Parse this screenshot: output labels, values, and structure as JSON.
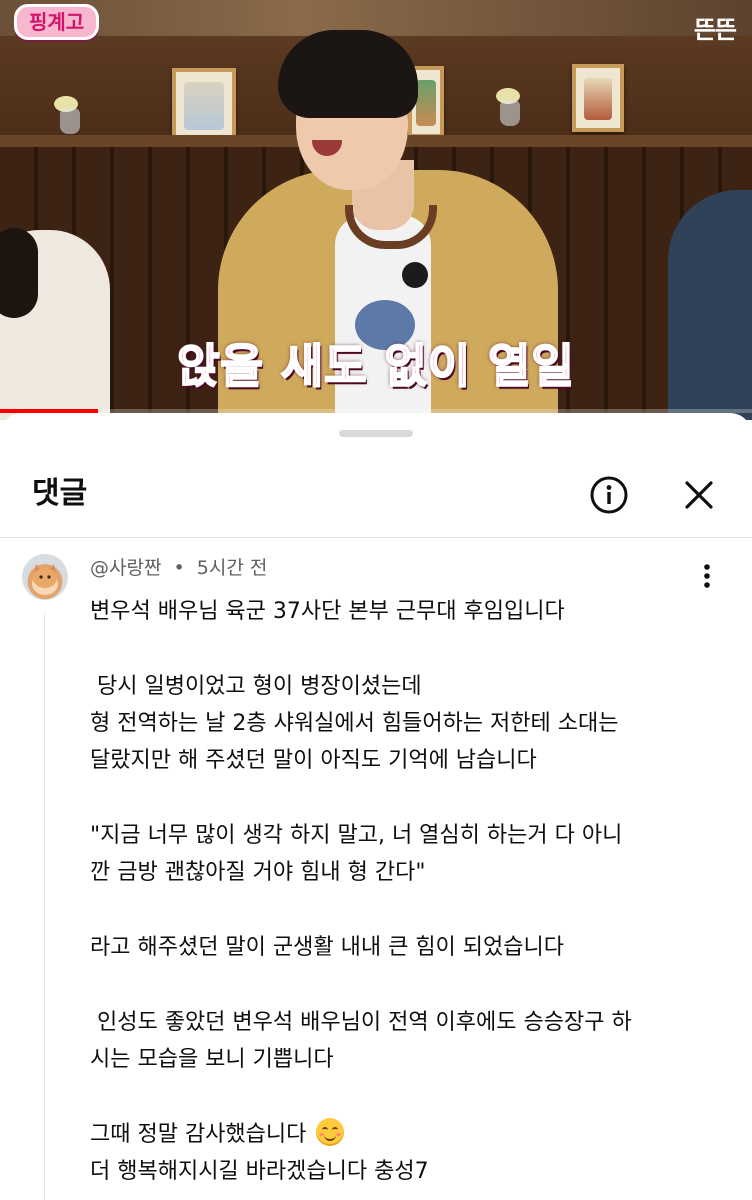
{
  "video": {
    "channel_logo": "핑계고",
    "brand_mark": "뜬뜬",
    "caption": "앉을 새도 없이 열일",
    "progress": 0.13
  },
  "comments_sheet": {
    "title": "댓글",
    "icons": {
      "info": "info-circle-icon",
      "close": "close-x-icon",
      "menu": "more-vertical-icon"
    },
    "comment": {
      "author": "@사랑짠",
      "separator": "•",
      "time": "5시간 전",
      "paragraphs": [
        [
          "변우석 배우님 육군 37사단 본부 근무대 후임입니다"
        ],
        [
          " 당시 일병이었고 형이 병장이셨는데",
          "형 전역하는 날 2층 샤워실에서 힘들어하는 저한테 소대는",
          "달랐지만 해 주셨던 말이 아직도 기억에 남습니다"
        ],
        [
          "\"지금 너무 많이 생각 하지 말고, 너 열심히 하는거 다 아니",
          "깐 금방 괜찮아질 거야 힘내 형 간다\""
        ],
        [
          "라고 해주셨던 말이 군생활 내내 큰 힘이 되었습니다"
        ],
        [
          " 인성도 좋았던 변우석 배우님이 전역 이후에도 승승장구 하",
          "시는 모습을 보니 기쁩니다"
        ],
        [
          "그때 정말 감사했습니다",
          "더 행복해지시길 바라겠습니다 충성7"
        ]
      ],
      "emoji": "smiling-face-icon"
    }
  }
}
